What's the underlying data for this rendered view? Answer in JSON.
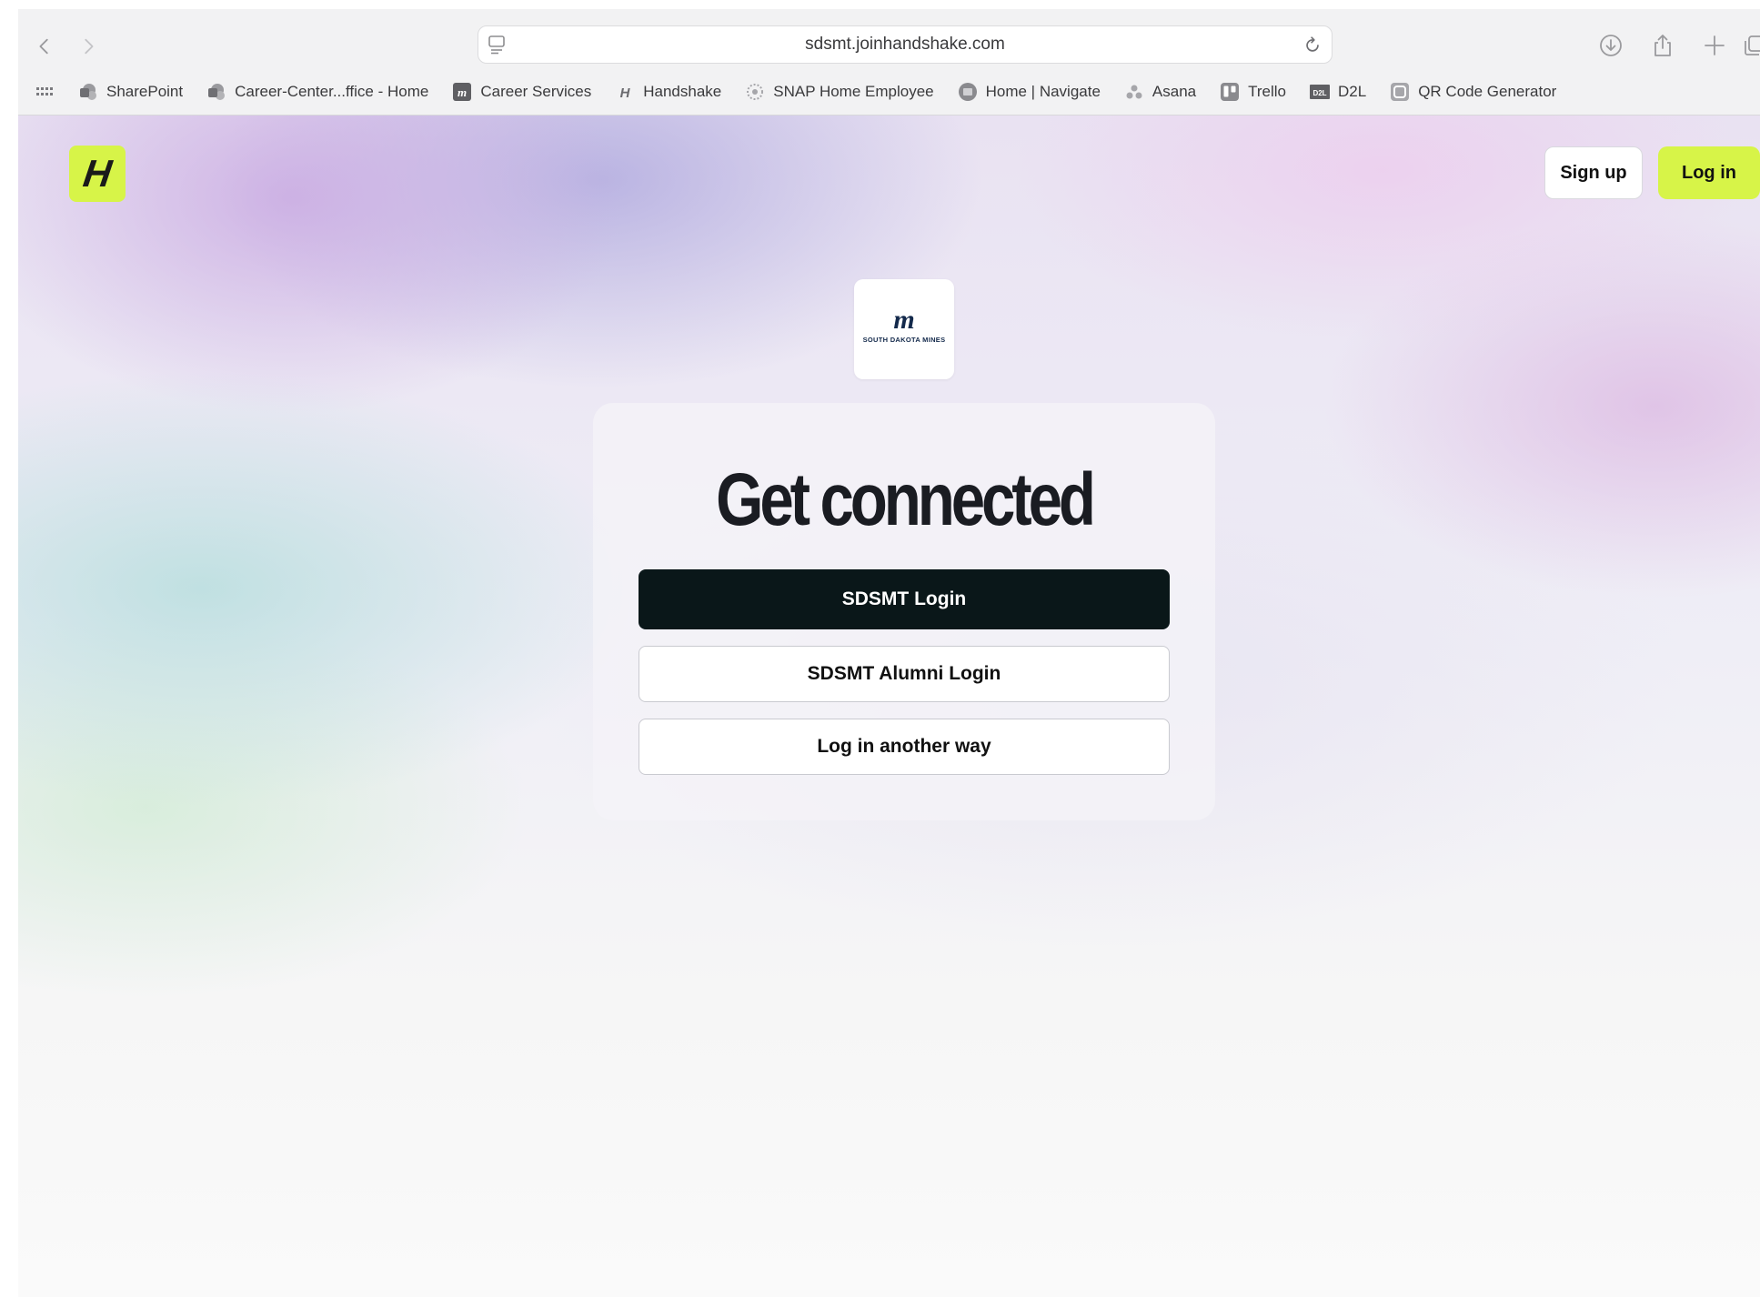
{
  "browser": {
    "url": "sdsmt.joinhandshake.com",
    "bookmarks": [
      {
        "label": "SharePoint",
        "icon": "sharepoint-icon"
      },
      {
        "label": "Career-Center...ffice - Home",
        "icon": "sharepoint-icon"
      },
      {
        "label": "Career Services",
        "icon": "mines-icon"
      },
      {
        "label": "Handshake",
        "icon": "handshake-icon"
      },
      {
        "label": "SNAP Home Employee",
        "icon": "snap-icon"
      },
      {
        "label": "Home | Navigate",
        "icon": "navigate-icon"
      },
      {
        "label": "Asana",
        "icon": "asana-icon"
      },
      {
        "label": "Trello",
        "icon": "trello-icon"
      },
      {
        "label": "D2L",
        "icon": "d2l-icon"
      },
      {
        "label": "QR Code Generator",
        "icon": "qr-icon"
      }
    ]
  },
  "header": {
    "logo_letter": "H",
    "signup_label": "Sign up",
    "login_label": "Log in",
    "brand_color": "#d7f448"
  },
  "school": {
    "logo_mark": "m",
    "logo_text": "SOUTH DAKOTA MINES"
  },
  "card": {
    "title": "Get connected",
    "primary_button": "SDSMT Login",
    "alumni_button": "SDSMT Alumni Login",
    "other_button": "Log in another way"
  }
}
